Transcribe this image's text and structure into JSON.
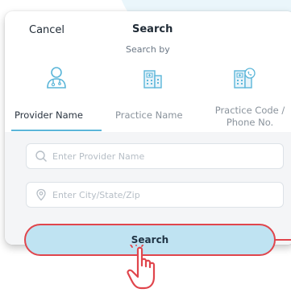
{
  "header": {
    "cancel_label": "Cancel",
    "title": "Search",
    "subtitle": "Search by"
  },
  "tabs": [
    {
      "label": "Provider Name",
      "icon": "doctor-icon",
      "active": true
    },
    {
      "label": "Practice Name",
      "icon": "building-icon",
      "active": false
    },
    {
      "label_line1": "Practice Code /",
      "label_line2": "Phone No.",
      "icon": "building-phone-icon",
      "active": false
    }
  ],
  "form": {
    "provider_placeholder": "Enter Provider Name",
    "location_placeholder": "Enter City/State/Zip",
    "search_button_label": "Search"
  },
  "colors": {
    "accent": "#5bb6d9",
    "button_fill": "#bfe3f2",
    "highlight": "#e0454c"
  }
}
